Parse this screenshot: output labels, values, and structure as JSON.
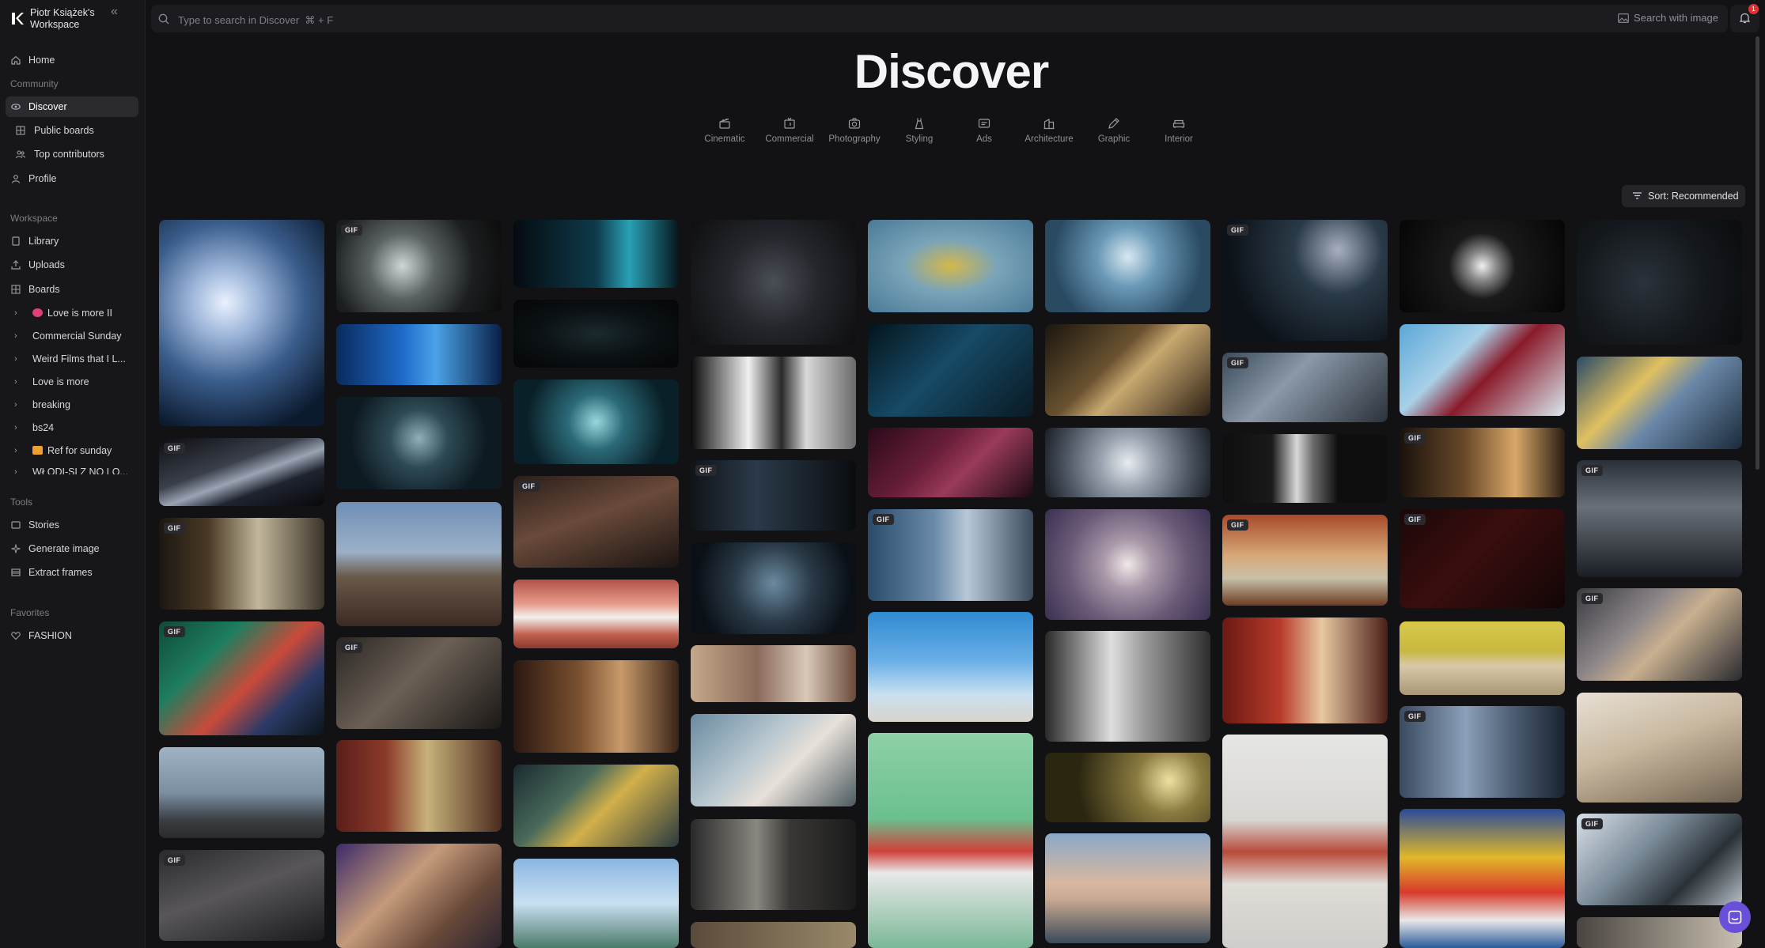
{
  "workspace": {
    "name": "Piotr Książek's Workspace"
  },
  "nav": {
    "home": "Home",
    "community_label": "Community",
    "discover": "Discover",
    "public_boards": "Public boards",
    "top_contributors": "Top contributors",
    "profile": "Profile",
    "workspace_label": "Workspace",
    "library": "Library",
    "uploads": "Uploads",
    "boards": "Boards",
    "board_items": [
      "Love is more II",
      "Commercial Sunday",
      "Weird Films that I L...",
      "Love is more",
      "breaking",
      "bs24",
      "Ref for sunday",
      "WŁODI-SLZ NO LO..."
    ],
    "tools_label": "Tools",
    "stories": "Stories",
    "generate_image": "Generate image",
    "extract_frames": "Extract frames",
    "favorites_label": "Favorites",
    "fashion": "FASHION"
  },
  "search": {
    "placeholder": "Type to search in Discover  ⌘ + F",
    "search_with_image": "Search with image"
  },
  "notifications": {
    "count": "1"
  },
  "header": {
    "title": "Discover"
  },
  "categories": [
    {
      "label": "Cinematic",
      "icon": "clapperboard-icon"
    },
    {
      "label": "Commercial",
      "icon": "tv-icon"
    },
    {
      "label": "Photography",
      "icon": "camera-icon"
    },
    {
      "label": "Styling",
      "icon": "dress-icon"
    },
    {
      "label": "Ads",
      "icon": "ad-icon"
    },
    {
      "label": "Architecture",
      "icon": "building-icon"
    },
    {
      "label": "Graphic",
      "icon": "pen-icon"
    },
    {
      "label": "Interior",
      "icon": "sofa-icon"
    }
  ],
  "sort": {
    "label": "Sort: Recommended"
  },
  "gif_badge": "GIF",
  "colors": {
    "background": "#121214",
    "sidebar": "#17171a",
    "active": "#2a2a2f",
    "badge": "#e03434",
    "chat": "#6a4fd8"
  }
}
